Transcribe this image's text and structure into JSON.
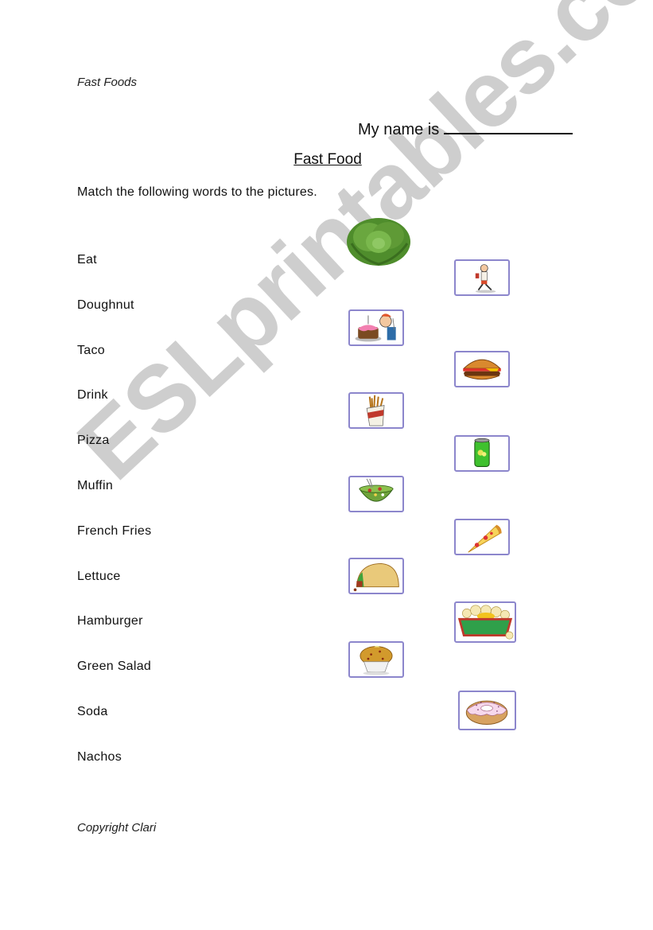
{
  "header_note": "Fast Foods",
  "name_prompt": "My name is",
  "title": "Fast Food",
  "instruction": "Match the following words to the pictures.",
  "words": [
    "Eat",
    "Doughnut",
    "Taco",
    "Drink",
    "Pizza",
    "Muffin",
    "French Fries",
    "Lettuce",
    "Hamburger",
    "Green Salad",
    "Soda",
    "Nachos"
  ],
  "pictures": [
    {
      "icon": "lettuce-icon",
      "column": "left"
    },
    {
      "icon": "drinking-man-icon",
      "column": "right"
    },
    {
      "icon": "man-eating-cake-icon",
      "column": "left"
    },
    {
      "icon": "hamburger-icon",
      "column": "right"
    },
    {
      "icon": "french-fries-icon",
      "column": "left"
    },
    {
      "icon": "soda-can-icon",
      "column": "right"
    },
    {
      "icon": "green-salad-icon",
      "column": "left"
    },
    {
      "icon": "pizza-slice-icon",
      "column": "right"
    },
    {
      "icon": "taco-icon",
      "column": "left"
    },
    {
      "icon": "nachos-icon",
      "column": "right"
    },
    {
      "icon": "muffin-icon",
      "column": "left"
    },
    {
      "icon": "doughnut-icon",
      "column": "right"
    }
  ],
  "footer_note": "Copyright Clari",
  "watermark": "ESLprintables.com",
  "colors": {
    "frame_border": "#8c86cc",
    "watermark": "#c4c4c4"
  }
}
